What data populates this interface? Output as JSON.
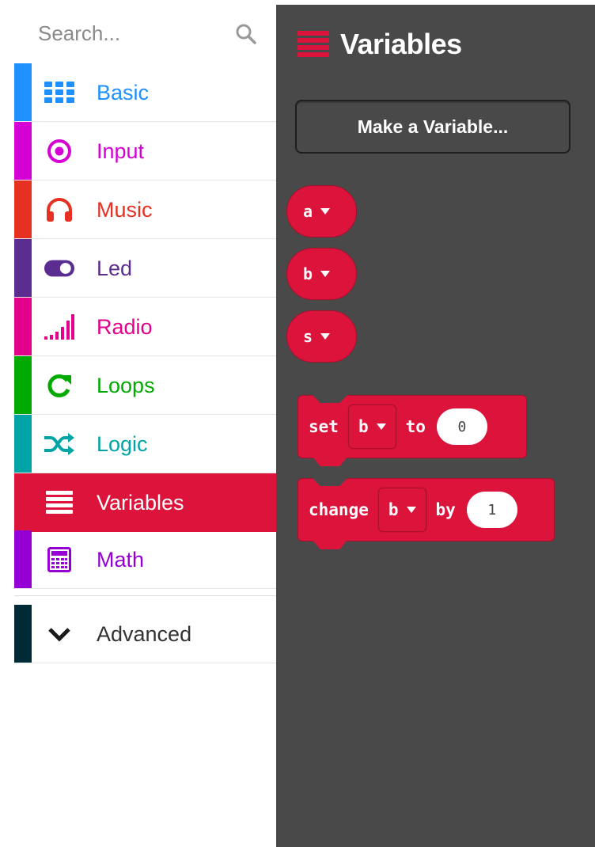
{
  "search": {
    "placeholder": "Search..."
  },
  "categories": [
    {
      "label": "Basic",
      "icon": "grid-icon",
      "color": "#1e90ff"
    },
    {
      "label": "Input",
      "icon": "target-icon",
      "color": "#d400d4"
    },
    {
      "label": "Music",
      "icon": "headphones-icon",
      "color": "#e63022"
    },
    {
      "label": "Led",
      "icon": "toggle-icon",
      "color": "#5c2d91"
    },
    {
      "label": "Radio",
      "icon": "signal-bars-icon",
      "color": "#e3008c"
    },
    {
      "label": "Loops",
      "icon": "refresh-icon",
      "color": "#00aa00"
    },
    {
      "label": "Logic",
      "icon": "shuffle-icon",
      "color": "#00a4a6"
    },
    {
      "label": "Variables",
      "icon": "list-icon",
      "color": "#dc143c"
    },
    {
      "label": "Math",
      "icon": "calculator-icon",
      "color": "#9400d3"
    },
    {
      "label": "Advanced",
      "icon": "chevron-down-icon",
      "color": "#002b36"
    }
  ],
  "flyout": {
    "title": "Variables",
    "make_variable_label": "Make a Variable...",
    "variables": [
      "a",
      "b",
      "s"
    ],
    "set_block": {
      "keyword": "set",
      "variable": "b",
      "connector": "to",
      "value": "0"
    },
    "change_block": {
      "keyword": "change",
      "variable": "b",
      "connector": "by",
      "value": "1"
    }
  },
  "colors": {
    "variables_accent": "#dc143c",
    "flyout_background": "#4a4949",
    "advanced_bar": "#002b36"
  }
}
